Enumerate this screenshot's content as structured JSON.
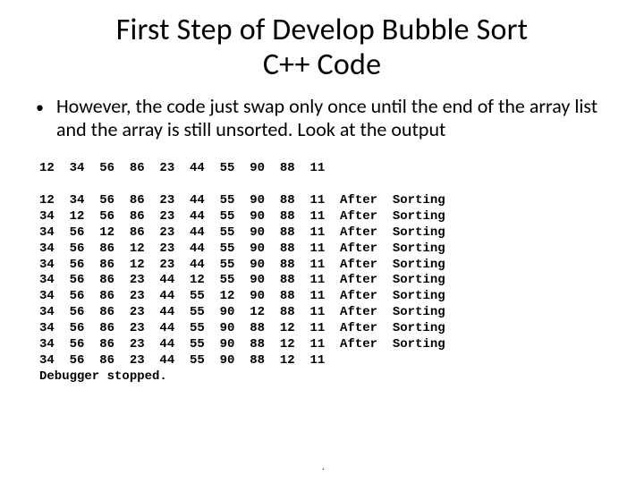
{
  "title_line1": "First Step of Develop Bubble Sort",
  "title_line2": "C++ Code",
  "bullet_text": "However, the code just swap only once until the end of the array list and the array is still unsorted. Look at the output",
  "console": {
    "header_row": "12  34  56  86  23  44  55  90  88  11",
    "after_label": "After  Sorting",
    "rows": [
      "12  34  56  86  23  44  55  90  88  11",
      "34  12  56  86  23  44  55  90  88  11",
      "34  56  12  86  23  44  55  90  88  11",
      "34  56  86  12  23  44  55  90  88  11",
      "34  56  86  12  23  44  55  90  88  11",
      "34  56  86  23  44  12  55  90  88  11",
      "34  56  86  23  44  55  12  90  88  11",
      "34  56  86  23  44  55  90  12  88  11",
      "34  56  86  23  44  55  90  88  12  11",
      "34  56  86  23  44  55  90  88  12  11"
    ],
    "final_row": "34  56  86  23  44  55  90  88  12  11",
    "stopped": "Debugger stopped."
  }
}
